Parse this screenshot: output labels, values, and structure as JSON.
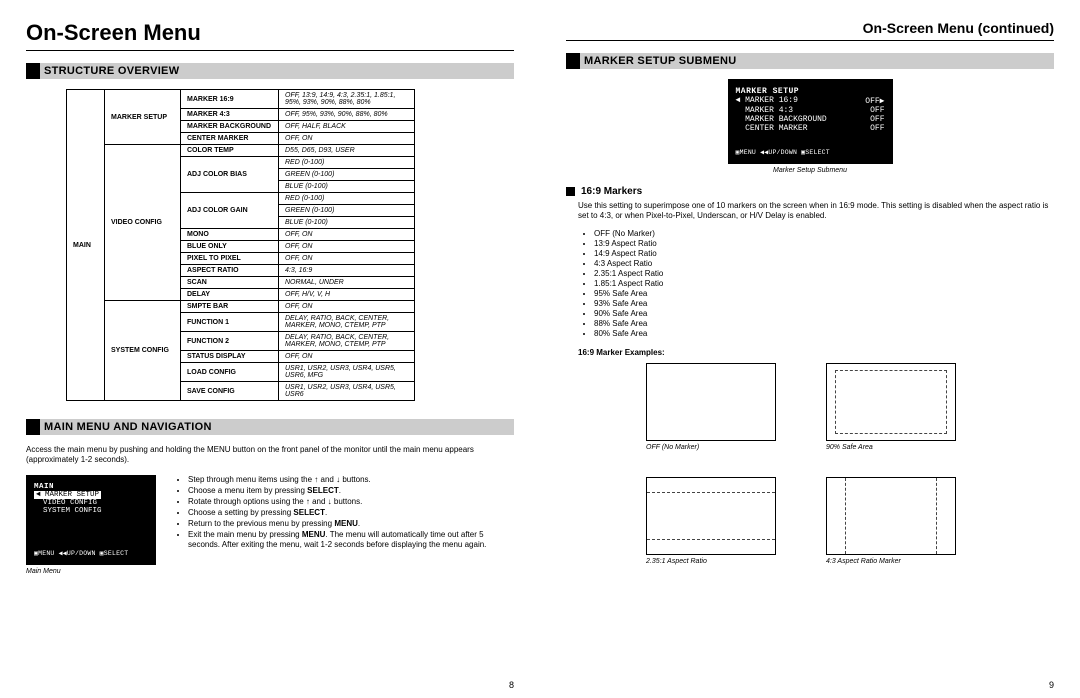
{
  "left": {
    "page_title": "On-Screen Menu",
    "section1": "STRUCTURE OVERVIEW",
    "section2": "MAIN MENU AND NAVIGATION",
    "page_num": "8",
    "intro": "Access the main menu by pushing and holding the MENU button on the front panel of the monitor until the main menu appears (approximately 1-2 seconds).",
    "osd_caption": "Main Menu",
    "osd": {
      "title": "MAIN",
      "items": [
        "MARKER SETUP",
        "VIDEO CONFIG",
        "SYSTEM CONFIG"
      ],
      "legend": "▣MENU ◀◀UP/DOWN ▣SELECT"
    },
    "bullets": [
      "Step through menu items using the ↑ and ↓ buttons.",
      "Choose a menu item by pressing SELECT.",
      "Rotate through options using the ↑ and ↓ buttons.",
      "Choose a setting by pressing SELECT.",
      "Return to the previous menu by pressing MENU.",
      "Exit the main menu by pressing MENU. The menu will automatically time out after 5 seconds. After exiting the menu, wait 1-2 seconds before displaying the menu again."
    ],
    "table": {
      "c1": "MAIN",
      "groups": [
        {
          "c2": "MARKER SETUP",
          "rows": [
            {
              "c3": "MARKER 16:9",
              "v": "OFF, 13:9, 14:9, 4:3, 2.35:1, 1.85:1, 95%, 93%, 90%, 88%, 80%"
            },
            {
              "c3": "MARKER 4:3",
              "v": "OFF, 95%, 93%, 90%, 88%, 80%"
            },
            {
              "c3": "MARKER BACKGROUND",
              "v": "OFF, HALF, BLACK"
            },
            {
              "c3": "CENTER MARKER",
              "v": "OFF, ON"
            }
          ]
        },
        {
          "c2": "VIDEO CONFIG",
          "rows": [
            {
              "c3": "COLOR TEMP",
              "v": "D55, D65, D93, USER"
            },
            {
              "c3": "ADJ COLOR BIAS",
              "v": "RED (0-100)\nGREEN (0-100)\nBLUE (0-100)",
              "span": 3
            },
            {
              "c3": "ADJ COLOR GAIN",
              "v": "RED (0-100)\nGREEN (0-100)\nBLUE (0-100)",
              "span": 3
            },
            {
              "c3": "MONO",
              "v": "OFF, ON"
            },
            {
              "c3": "BLUE ONLY",
              "v": "OFF, ON"
            },
            {
              "c3": "PIXEL TO PIXEL",
              "v": "OFF, ON"
            },
            {
              "c3": "ASPECT RATIO",
              "v": "4:3, 16:9"
            },
            {
              "c3": "SCAN",
              "v": "NORMAL, UNDER"
            },
            {
              "c3": "DELAY",
              "v": "OFF, H/V, V, H"
            }
          ]
        },
        {
          "c2": "SYSTEM CONFIG",
          "rows": [
            {
              "c3": "SMPTE BAR",
              "v": "OFF, ON"
            },
            {
              "c3": "FUNCTION 1",
              "v": "DELAY, RATIO, BACK, CENTER, MARKER, MONO, CTEMP, PTP"
            },
            {
              "c3": "FUNCTION 2",
              "v": "DELAY, RATIO, BACK, CENTER, MARKER, MONO, CTEMP, PTP"
            },
            {
              "c3": "STATUS DISPLAY",
              "v": "OFF, ON"
            },
            {
              "c3": "LOAD CONFIG",
              "v": "USR1, USR2, USR3, USR4, USR5, USR6, MFG"
            },
            {
              "c3": "SAVE CONFIG",
              "v": "USR1, USR2, USR3, USR4, USR5, USR6"
            }
          ]
        }
      ]
    }
  },
  "right": {
    "page_title": "On-Screen Menu (continued)",
    "section1": "MARKER SETUP SUBMENU",
    "page_num": "9",
    "osd_caption": "Marker Setup Submenu",
    "osd": {
      "title": "MARKER SETUP",
      "rows": [
        {
          "l": "MARKER 16:9",
          "r": "OFF▶",
          "sel": true
        },
        {
          "l": "MARKER 4:3",
          "r": "OFF"
        },
        {
          "l": "MARKER BACKGROUND",
          "r": "OFF"
        },
        {
          "l": "CENTER MARKER",
          "r": "OFF"
        }
      ],
      "legend": "▣MENU ◀◀UP/DOWN ▣SELECT"
    },
    "sub_head": "16:9 Markers",
    "sub_body": "Use this setting to superimpose one of 10 markers on the screen when in 16:9 mode. This setting is disabled when the aspect ratio is set to 4:3, or when Pixel-to-Pixel, Underscan, or H/V Delay is enabled.",
    "options": [
      "OFF (No Marker)",
      "13:9 Aspect Ratio",
      "14:9 Aspect Ratio",
      "4:3 Aspect Ratio",
      "2.35:1 Aspect Ratio",
      "1.85:1 Aspect Ratio",
      "95% Safe Area",
      "93% Safe Area",
      "90% Safe Area",
      "88% Safe Area",
      "80% Safe Area"
    ],
    "examples_label": "16:9 Marker Examples:",
    "thumbs": [
      {
        "caption": "OFF (No Marker)",
        "mode": "none"
      },
      {
        "caption": "90% Safe Area",
        "mode": "safe"
      },
      {
        "caption": "2.35:1 Aspect Ratio",
        "mode": "235"
      },
      {
        "caption": "4:3 Aspect Ratio Marker",
        "mode": "43"
      }
    ]
  }
}
